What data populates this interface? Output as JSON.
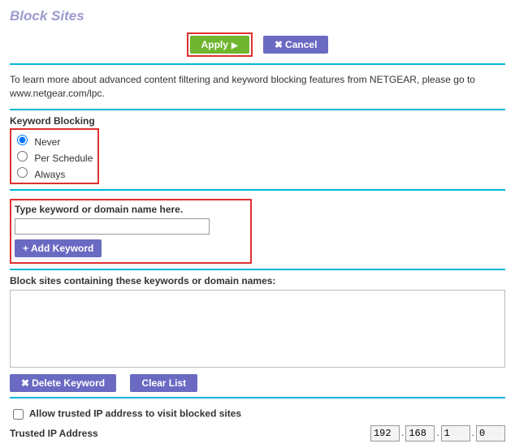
{
  "title": "Block Sites",
  "buttons": {
    "apply": "Apply",
    "cancel": "Cancel",
    "add_keyword": "Add Keyword",
    "delete_keyword": "Delete Keyword",
    "clear_list": "Clear List"
  },
  "info": {
    "text": "To learn more about advanced content filtering and keyword blocking features from NETGEAR, please go to www.netgear.com/lpc."
  },
  "keyword_blocking": {
    "heading": "Keyword Blocking",
    "options": {
      "never": "Never",
      "per_schedule": "Per Schedule",
      "always": "Always"
    },
    "selected": "never"
  },
  "keyword_input": {
    "label": "Type keyword or domain name here.",
    "value": ""
  },
  "block_list": {
    "heading": "Block sites containing these keywords or domain names:"
  },
  "trusted": {
    "checkbox_label": "Allow trusted IP address to visit blocked sites",
    "checked": false,
    "label": "Trusted IP Address",
    "octets": [
      "192",
      "168",
      "1",
      "0"
    ]
  },
  "icons": {
    "play": "▶",
    "close": "✖",
    "plus": "+"
  }
}
